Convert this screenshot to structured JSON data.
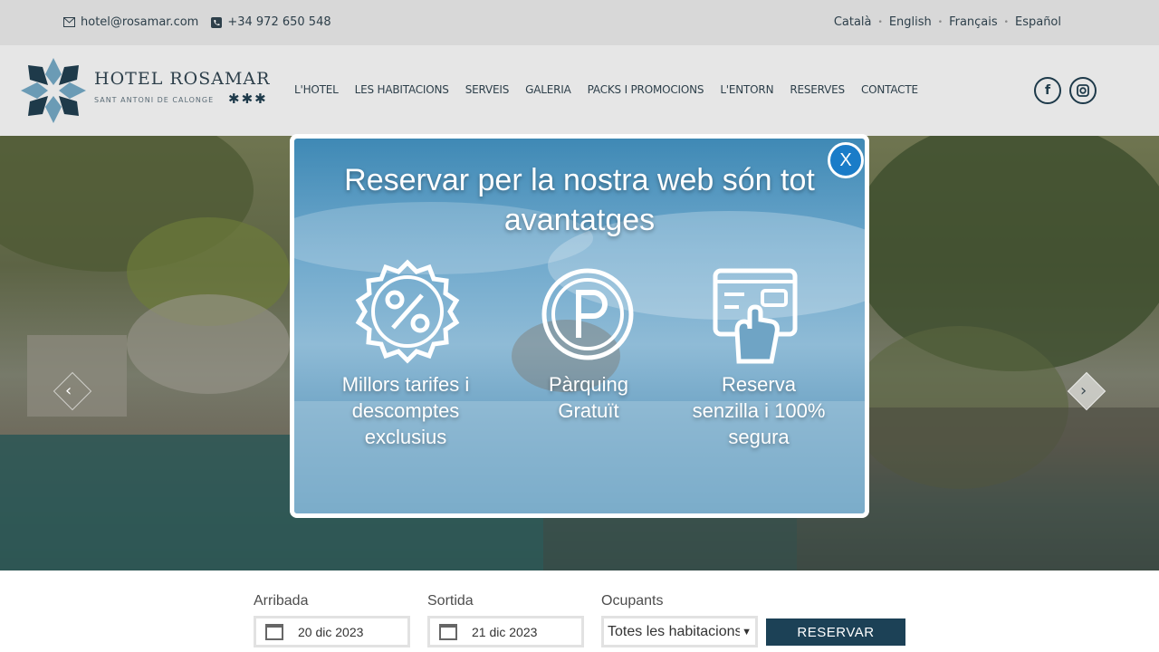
{
  "topbar": {
    "email": "hotel@rosamar.com",
    "phone": "+34 972 650 548",
    "languages": [
      "Català",
      "English",
      "Français",
      "Español"
    ]
  },
  "header": {
    "logo_name": "HOTEL ROSAMAR",
    "logo_sub": "SANT ANTONI DE CALONGE",
    "logo_stars": "✱✱✱",
    "nav": [
      "L'HOTEL",
      "LES HABITACIONS",
      "SERVEIS",
      "GALERIA",
      "PACKS I PROMOCIONS",
      "L'ENTORN",
      "RESERVES",
      "CONTACTE"
    ],
    "social": [
      "facebook-icon",
      "instagram-icon"
    ]
  },
  "popup": {
    "title": "Reservar per la nostra web són tot avantatges",
    "close_label": "X",
    "features": [
      {
        "label": "Millors tarifes i descomptes exclusius",
        "icon": "discount-badge-icon"
      },
      {
        "label": "Pàrquing Gratuït",
        "icon": "parking-icon"
      },
      {
        "label": "Reserva senzilla i 100% segura",
        "icon": "online-booking-icon"
      }
    ]
  },
  "booking": {
    "arrival_label": "Arribada",
    "arrival_value": "20 dic 2023",
    "departure_label": "Sortida",
    "departure_value": "21 dic 2023",
    "occupants_label": "Ocupants",
    "occupants_value": "Totes les habitacions",
    "submit_label": "RESERVAR"
  },
  "colors": {
    "brand_dark": "#1c4156",
    "close_blue": "#1a7cc8"
  }
}
